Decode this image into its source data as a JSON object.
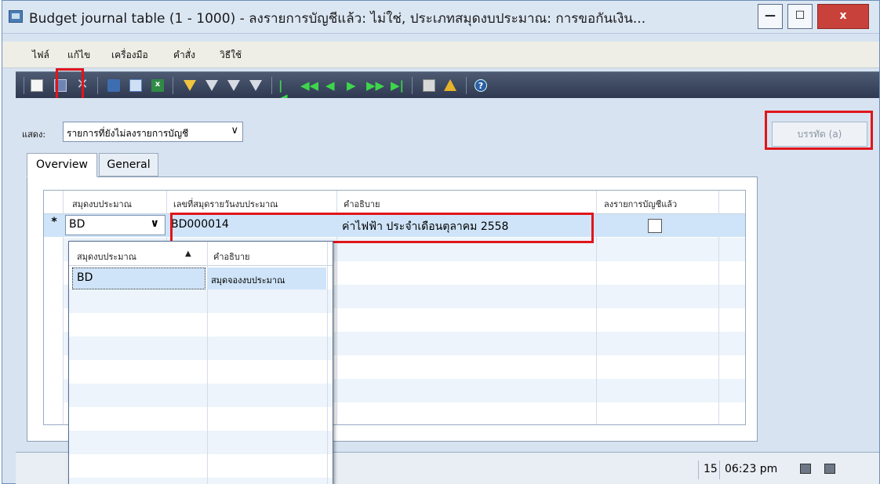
{
  "window": {
    "title": "Budget journal table (1 - 1000) - ลงรายการบัญชีแล้ว: ไม่ใช่, ประเภทสมุดงบประมาณ: การขอกันเงิน...",
    "minimize_glyph": "—",
    "maximize_glyph": "☐",
    "close_glyph": "x"
  },
  "menu": {
    "items": [
      "ไฟล์",
      "แก้ไข",
      "เครื่องมือ",
      "คำสั่ง",
      "วิธีใช้"
    ]
  },
  "toolbar": {
    "icons": [
      "new-doc-icon",
      "save-icon",
      "delete-icon",
      "print-icon",
      "print-preview-icon",
      "export-excel-icon",
      "filter-by-field-icon",
      "filter-by-selection-icon",
      "advanced-filter-icon",
      "remove-filter-icon",
      "first-record-icon",
      "previous-page-icon",
      "previous-record-icon",
      "next-record-icon",
      "next-page-icon",
      "last-record-icon",
      "document-handling-icon",
      "alert-icon",
      "help-icon"
    ],
    "excel_glyph": "x",
    "help_glyph": "?",
    "nav_glyphs": [
      "|◀",
      "◀◀",
      "◀",
      "▶",
      "▶▶",
      "▶|"
    ]
  },
  "filter": {
    "label": "แสดง:",
    "value": "รายการที่ยังไม่ลงรายการบัญชี",
    "chevron": "∨"
  },
  "actions": {
    "lines_button": "บรรทัด (a)"
  },
  "tabs": [
    "Overview",
    "General"
  ],
  "grid": {
    "columns": [
      "สมุดงบประมาณ",
      "เลขที่สมุดรายวันงบประมาณ",
      "คำอธิบาย",
      "ลงรายการบัญชีแล้ว"
    ],
    "rows": [
      {
        "marker": "*",
        "budget_model": "BD",
        "journal_number": "BD000014",
        "description": "ค่าไฟฟ้า ประจำเดือนตุลาคม 2558",
        "posted": false
      }
    ],
    "dropdown_chevron": "∨"
  },
  "lookup": {
    "columns": [
      "สมุดงบประมาณ",
      "คำอธิบาย"
    ],
    "sort_glyph": "▲",
    "rows": [
      {
        "code": "BD",
        "description": "สมุดจองงบประมาณ"
      }
    ]
  },
  "status_bar": {
    "date_fragment": "15",
    "time": "06:23 pm"
  },
  "colors": {
    "highlight_red": "#e0151b",
    "selection_blue": "#cfe4f8",
    "toolbar_dark": "#2f3a52"
  }
}
